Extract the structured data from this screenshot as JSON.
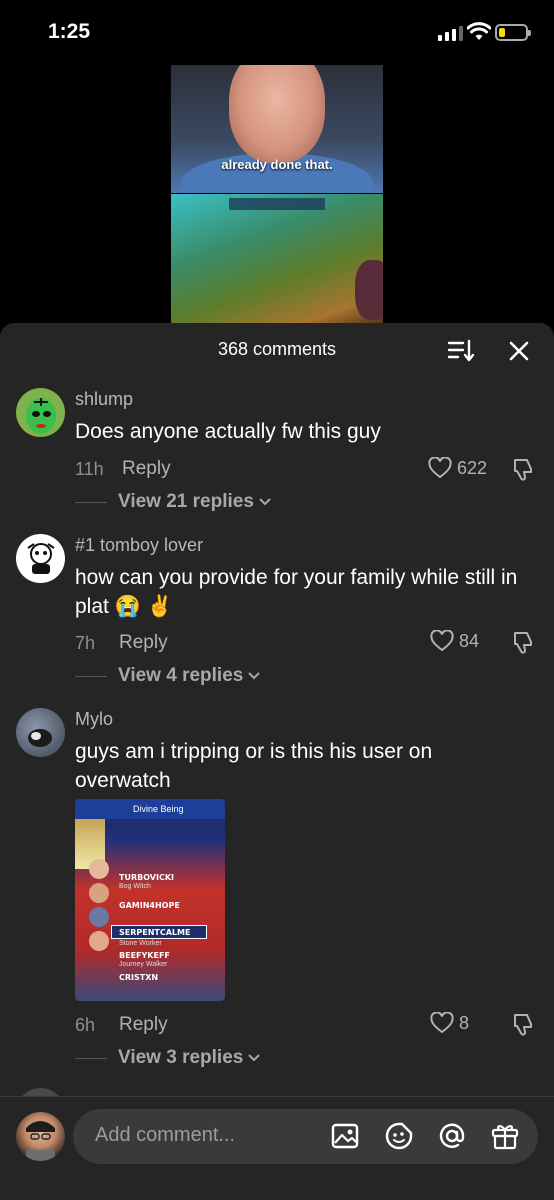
{
  "status": {
    "time": "1:25"
  },
  "video": {
    "caption": "already done that."
  },
  "sheet": {
    "comment_count": "368 comments",
    "comments": [
      {
        "username": "shlump",
        "text": "Does anyone actually fw this guy",
        "age": "11h",
        "reply_label": "Reply",
        "likes": "622",
        "view_replies": "View 21 replies"
      },
      {
        "username": "#1 tomboy lover",
        "text": "how can you provide for your family while still in plat 😭 ✌️",
        "age": "7h",
        "reply_label": "Reply",
        "likes": "84",
        "view_replies": "View 4 replies"
      },
      {
        "username": "Mylo",
        "text": "guys am i tripping or is this his user on overwatch",
        "age": "6h",
        "reply_label": "Reply",
        "likes": "8",
        "view_replies": "View 3 replies",
        "image": {
          "header": "Divine Being",
          "players": [
            {
              "name": "TURBOVICKI",
              "title": "Bog Witch"
            },
            {
              "name": "GAMIN4HOPE",
              "title": ""
            },
            {
              "name": "SERPENTCALME",
              "title": "Stone Worker"
            },
            {
              "name": "BEEFYKEFF",
              "title": "Journey Walker"
            },
            {
              "name": "CRISTXN",
              "title": ""
            }
          ]
        }
      }
    ]
  },
  "composer": {
    "placeholder": "Add comment..."
  }
}
